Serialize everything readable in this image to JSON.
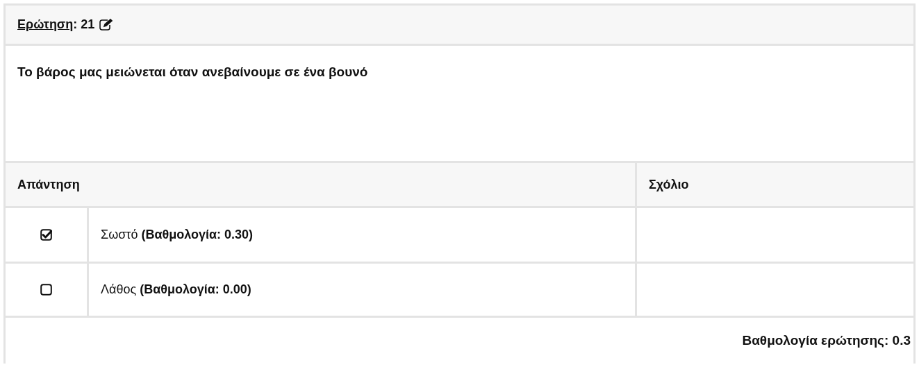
{
  "question_header": {
    "label": "Ερώτηση",
    "number": ": 21"
  },
  "question_text": "Το βάρος μας μειώνεται όταν ανεβαίνουμε σε ένα βουνό",
  "table": {
    "columns": [
      "Απάντηση",
      "Σχόλιο"
    ],
    "rows": [
      {
        "answer": "Σωστό **(Βαθμολογία: 0.30)**",
        "checked": true
      },
      {
        "answer": "Λάθος **(Βαθμολογία: 0.00)**",
        "checked": false
      }
    ]
  },
  "score": "Βαθμολογία ερώτησης: 0.3"
}
